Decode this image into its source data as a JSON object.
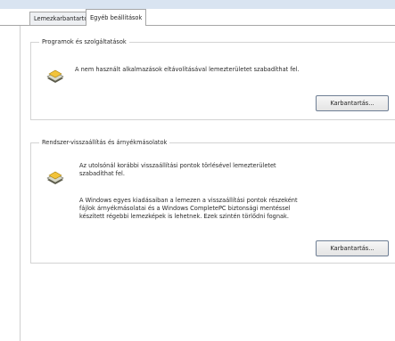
{
  "tabs": [
    {
      "label": "Lemezkarbantartó",
      "active": false
    },
    {
      "label": "Egyéb beállítások",
      "active": true
    }
  ],
  "programs_group": {
    "title": "Programok és szolgáltatások",
    "icon": "programs-disk-icon",
    "description": "A nem használt alkalmazások eltávolításával lemezterületet szabadíthat fel.",
    "button_label": "Karbantartás..."
  },
  "restore_group": {
    "title": "Rendszer-visszaállítás és árnyékmásolatok",
    "icon": "restore-disk-icon",
    "line1": "Az utolsónál korábbi visszaállítási pontok törlésével lemezterületet",
    "line2": "szabadíthat fel.",
    "para_line1": "A Windows egyes kiadásaiban a lemezen a visszaállítási pontok részeként",
    "para_line2": "fájlok árnyékmásolatai és a Windows CompletePC biztonsági mentéssel",
    "para_line3": "készített régebbi lemezképek is lehetnek. Ezek szintén törlődni fognak.",
    "button_label": "Karbantartás..."
  }
}
